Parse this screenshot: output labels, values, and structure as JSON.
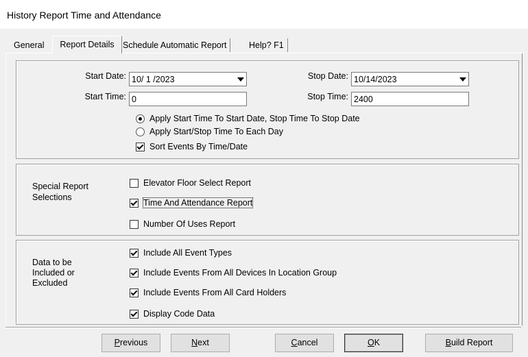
{
  "window": {
    "title": "History Report Time and Attendance"
  },
  "tabs": [
    {
      "label": "General"
    },
    {
      "label": "Report Details"
    },
    {
      "label": "Schedule Automatic Report"
    },
    {
      "label": "Help? F1"
    }
  ],
  "dates": {
    "start_date_label": "Start Date:",
    "start_date_value": "10/ 1 /2023",
    "stop_date_label": "Stop Date:",
    "stop_date_value": "10/14/2023",
    "start_time_label": "Start Time:",
    "start_time_value": "0",
    "stop_time_label": "Stop Time:",
    "stop_time_value": "2400",
    "radio_apply_start_stop": "Apply Start Time To Start Date, Stop Time To Stop Date",
    "radio_apply_each_day": "Apply Start/Stop Time To Each Day",
    "sort_events": "Sort Events By Time/Date"
  },
  "special": {
    "label_line1": "Special Report",
    "label_line2": "Selections",
    "elevator": "Elevator Floor Select Report",
    "time_attendance": "Time And Attendance Report",
    "number_of_uses": "Number Of Uses Report"
  },
  "data_incl": {
    "label_line1": "Data to be",
    "label_line2": "Included or",
    "label_line3": "Excluded",
    "all_event_types": "Include All Event Types",
    "all_devices": "Include Events From All Devices In Location Group",
    "all_card_holders": "Include Events From All Card Holders",
    "display_code": "Display Code Data"
  },
  "buttons": {
    "previous": {
      "first": "P",
      "rest": "revious"
    },
    "next": {
      "first": "N",
      "rest": "ext"
    },
    "cancel": {
      "first": "C",
      "rest": "ancel"
    },
    "ok": {
      "first": "O",
      "rest": "K"
    },
    "build": {
      "first": "B",
      "rest": "uild Report"
    }
  }
}
